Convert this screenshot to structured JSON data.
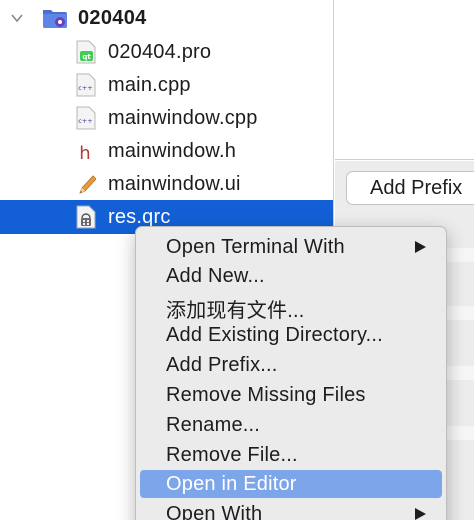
{
  "project_tree": {
    "project": {
      "name": "020404",
      "icon": "qt-project-folder-icon",
      "expanded": true
    },
    "files": [
      {
        "name": "020404.pro",
        "icon": "qt-project-file-icon"
      },
      {
        "name": "main.cpp",
        "icon": "cpp-file-icon"
      },
      {
        "name": "mainwindow.cpp",
        "icon": "cpp-file-icon"
      },
      {
        "name": "mainwindow.h",
        "icon": "header-file-icon"
      },
      {
        "name": "mainwindow.ui",
        "icon": "ui-form-file-icon"
      },
      {
        "name": "res.qrc",
        "icon": "qrc-resource-file-icon",
        "selected": true
      }
    ],
    "icon_texts": {
      "qt": "qt",
      "cpp": "c++",
      "header": "h"
    }
  },
  "resource_editor": {
    "add_prefix_label": "Add Prefix"
  },
  "context_menu": {
    "items": [
      {
        "label": "Open Terminal With",
        "has_submenu": true
      },
      {
        "label": "Add New..."
      },
      {
        "label": "添加现有文件..."
      },
      {
        "label": "Add Existing Directory..."
      },
      {
        "label": "Add Prefix..."
      },
      {
        "label": "Remove Missing Files"
      },
      {
        "label": "Rename..."
      },
      {
        "label": "Remove File..."
      },
      {
        "label": "Open in Editor",
        "highlighted": true
      },
      {
        "label": "Open With",
        "has_submenu": true
      }
    ]
  },
  "colors": {
    "selection": "#1360d6",
    "menu_highlight": "#7da6ea",
    "menu_background": "#ebebeb",
    "qt_green": "#41cd52",
    "project_folder": "#4a6fd0",
    "header_red": "#b43a3a"
  }
}
